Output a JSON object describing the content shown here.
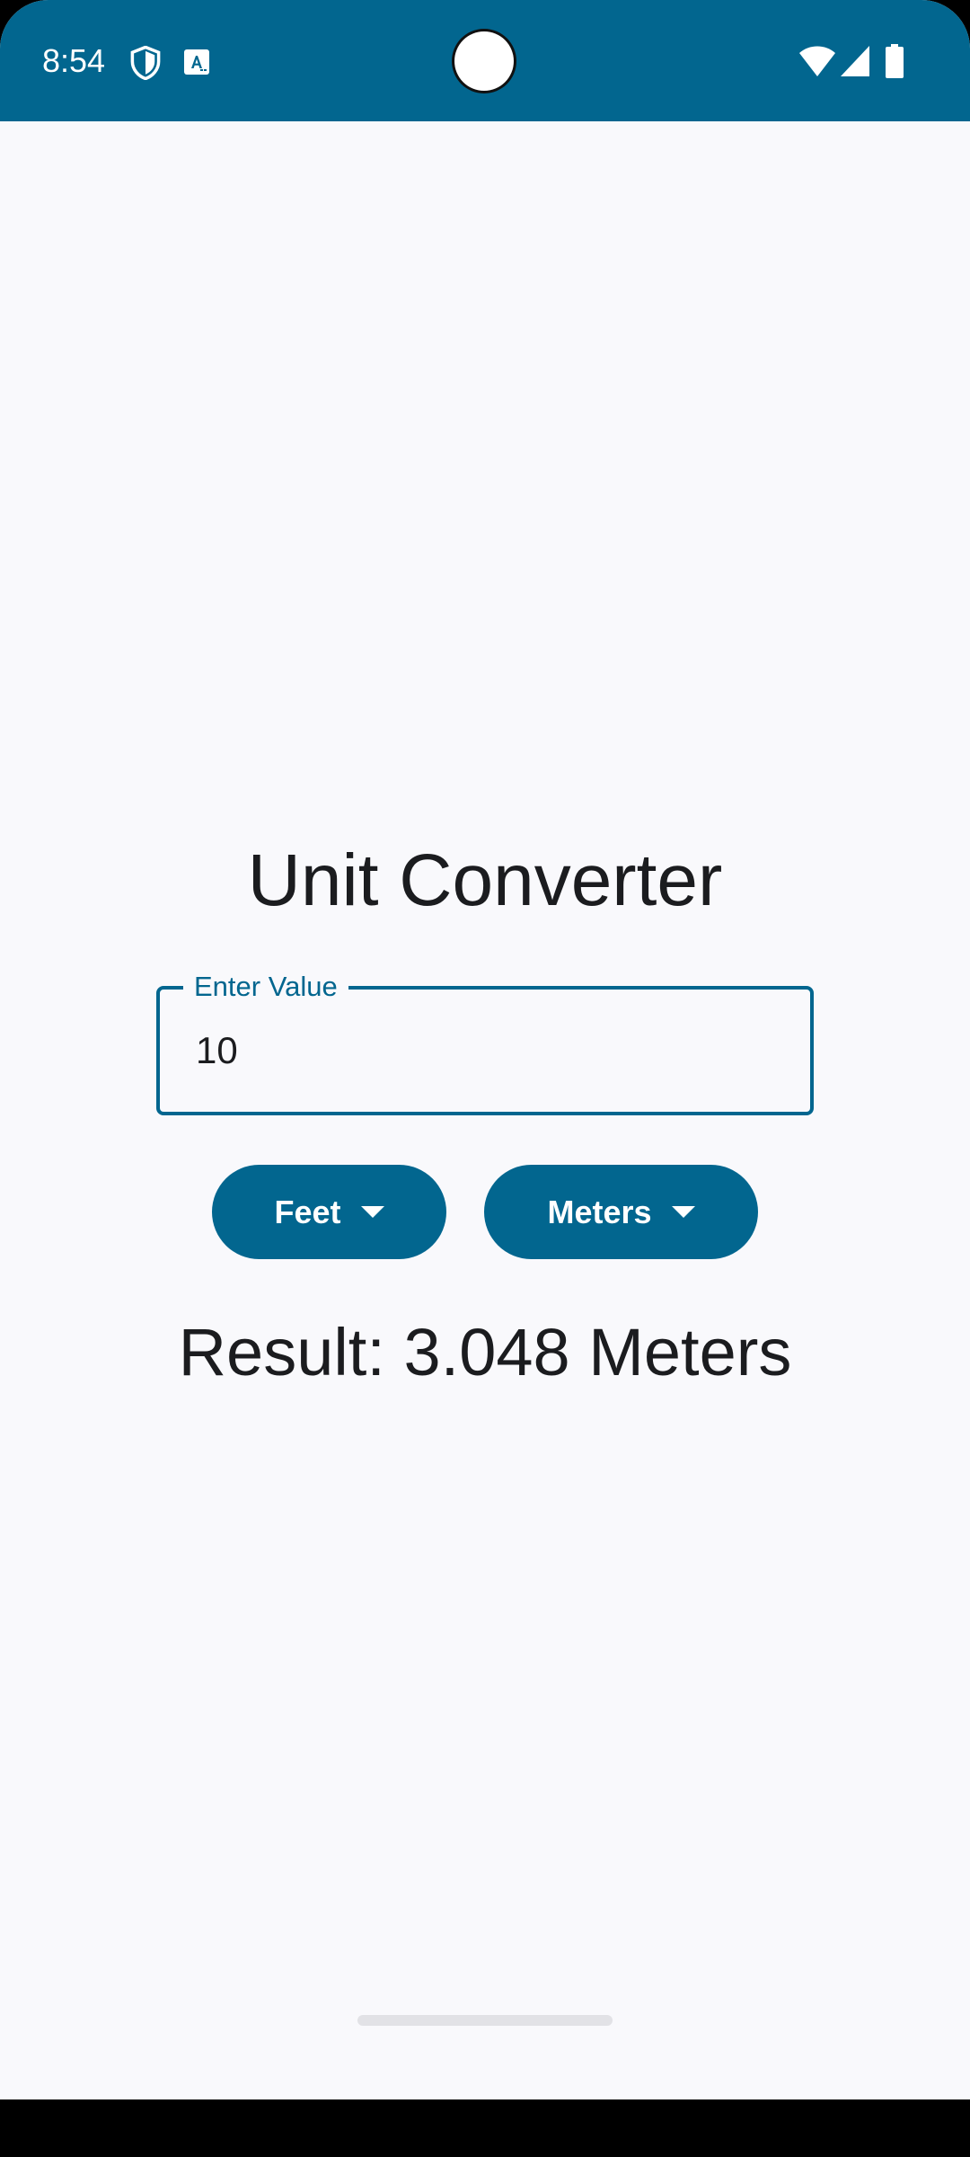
{
  "status_bar": {
    "time": "8:54",
    "left_icons": [
      "shield-icon",
      "translate-a-icon"
    ],
    "right_icons": [
      "wifi-icon",
      "signal-icon",
      "battery-icon"
    ],
    "color": "#02668f"
  },
  "app": {
    "title": "Unit Converter",
    "input": {
      "label": "Enter Value",
      "value": "10"
    },
    "from_unit": {
      "label": "Feet",
      "icon": "arrow-drop-down-icon"
    },
    "to_unit": {
      "label": "Meters",
      "icon": "arrow-drop-down-icon"
    },
    "result": "Result: 3.048 Meters"
  },
  "colors": {
    "primary": "#02668f",
    "background": "#f9f9fc",
    "text": "#1b1c1f"
  }
}
